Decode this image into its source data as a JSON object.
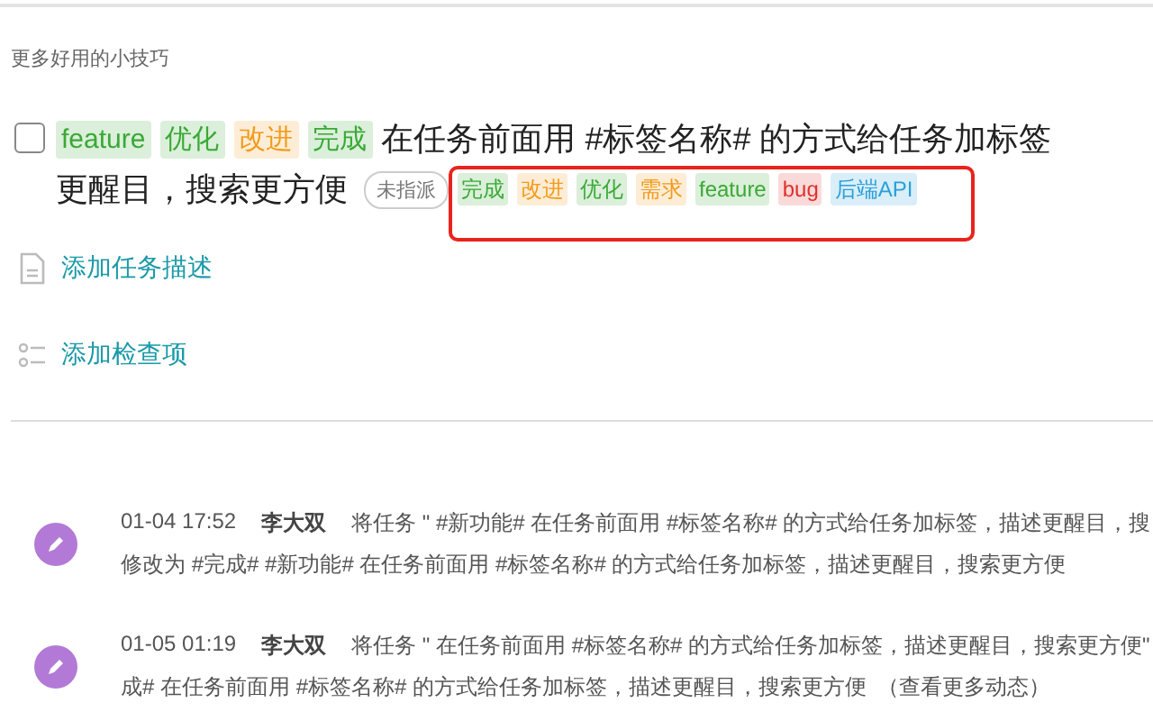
{
  "section_title": "更多好用的小技巧",
  "task": {
    "checked": false,
    "tags": [
      {
        "label": "feature",
        "color": "#3aa935"
      },
      {
        "label": "优化",
        "color": "#3aa935"
      },
      {
        "label": "改进",
        "color": "#f29b1b"
      },
      {
        "label": "完成",
        "color": "#3aa935"
      }
    ],
    "title_lines": [
      "在任务前面用 #标签名称# 的方式给任务加标签",
      "更醒目，搜索更方便"
    ],
    "assignee": "未指派",
    "suggested_tags": [
      {
        "label": "完成",
        "color": "#3aa935"
      },
      {
        "label": "改进",
        "color": "#f29b1b"
      },
      {
        "label": "优化",
        "color": "#3aa935"
      },
      {
        "label": "需求",
        "color": "#f29b1b"
      },
      {
        "label": "feature",
        "color": "#3aa935"
      },
      {
        "label": "bug",
        "color": "#e0302c"
      },
      {
        "label": "后端API",
        "color": "#2aa0d8"
      }
    ]
  },
  "actions": [
    {
      "kind": "description",
      "label": "添加任务描述"
    },
    {
      "kind": "checklist",
      "label": "添加检查项"
    }
  ],
  "activities": [
    {
      "time": "01-04 17:52",
      "user": "李大双",
      "line_1": "将任务 \" #新功能# 在任务前面用 #标签名称# 的方式给任务加标签，描述更醒目，搜",
      "line_2": "修改为 #完成# #新功能# 在任务前面用 #标签名称# 的方式给任务加标签，描述更醒目，搜索更方便"
    },
    {
      "time": "01-05 01:19",
      "user": "李大双",
      "line_1": "将任务 \" 在任务前面用 #标签名称# 的方式给任务加标签，描述更醒目，搜索更方便\"",
      "line_2": "成# 在任务前面用 #标签名称# 的方式给任务加标签，描述更醒目，搜索更方便",
      "link": "（查看更多动态）"
    }
  ]
}
